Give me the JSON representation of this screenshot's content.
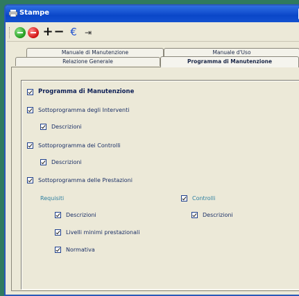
{
  "window": {
    "title": "Stampe",
    "close_label": "✕"
  },
  "toolbar": {
    "buttons": [
      {
        "name": "add-circle-icon"
      },
      {
        "name": "remove-circle-icon"
      },
      {
        "name": "plus-icon",
        "glyph": "+"
      },
      {
        "name": "minus-icon",
        "glyph": "−"
      },
      {
        "name": "euro-icon",
        "glyph": "€"
      },
      {
        "name": "exit-icon",
        "glyph": "⇥"
      }
    ]
  },
  "tabs": {
    "row_back": [
      "Manuale di Manutenzione",
      "Manuale d'Uso"
    ],
    "row_front": [
      "Relazione Generale",
      "Programma di Manutenzione"
    ],
    "active": "Programma di Manutenzione"
  },
  "options": {
    "programma": {
      "label": "Programma di Manutenzione",
      "checked": true
    },
    "interventi": {
      "label": "Sottoprogramma degli Interventi",
      "checked": true
    },
    "interventi_descrizioni": {
      "label": "Descrizioni",
      "checked": true
    },
    "controlli": {
      "label": "Sottoprogramma dei Controlli",
      "checked": true
    },
    "controlli_descrizioni": {
      "label": "Descrizioni",
      "checked": true
    },
    "prestazioni": {
      "label": "Sottoprogramma delle Prestazioni",
      "checked": true
    },
    "requisiti_label": "Requisiti",
    "req_descrizioni": {
      "label": "Descrizioni",
      "checked": true
    },
    "req_livelli": {
      "label": "Livelli minimi prestazionali",
      "checked": true
    },
    "req_normativa": {
      "label": "Normativa",
      "checked": true
    },
    "controlli2": {
      "label": "Controlli",
      "checked": true
    },
    "controlli2_descrizioni": {
      "label": "Descrizioni",
      "checked": true
    }
  },
  "colors": {
    "titlebar": "#0a46c8",
    "accent_group_label": "#2d7fa0",
    "background": "#2f7a5f"
  }
}
